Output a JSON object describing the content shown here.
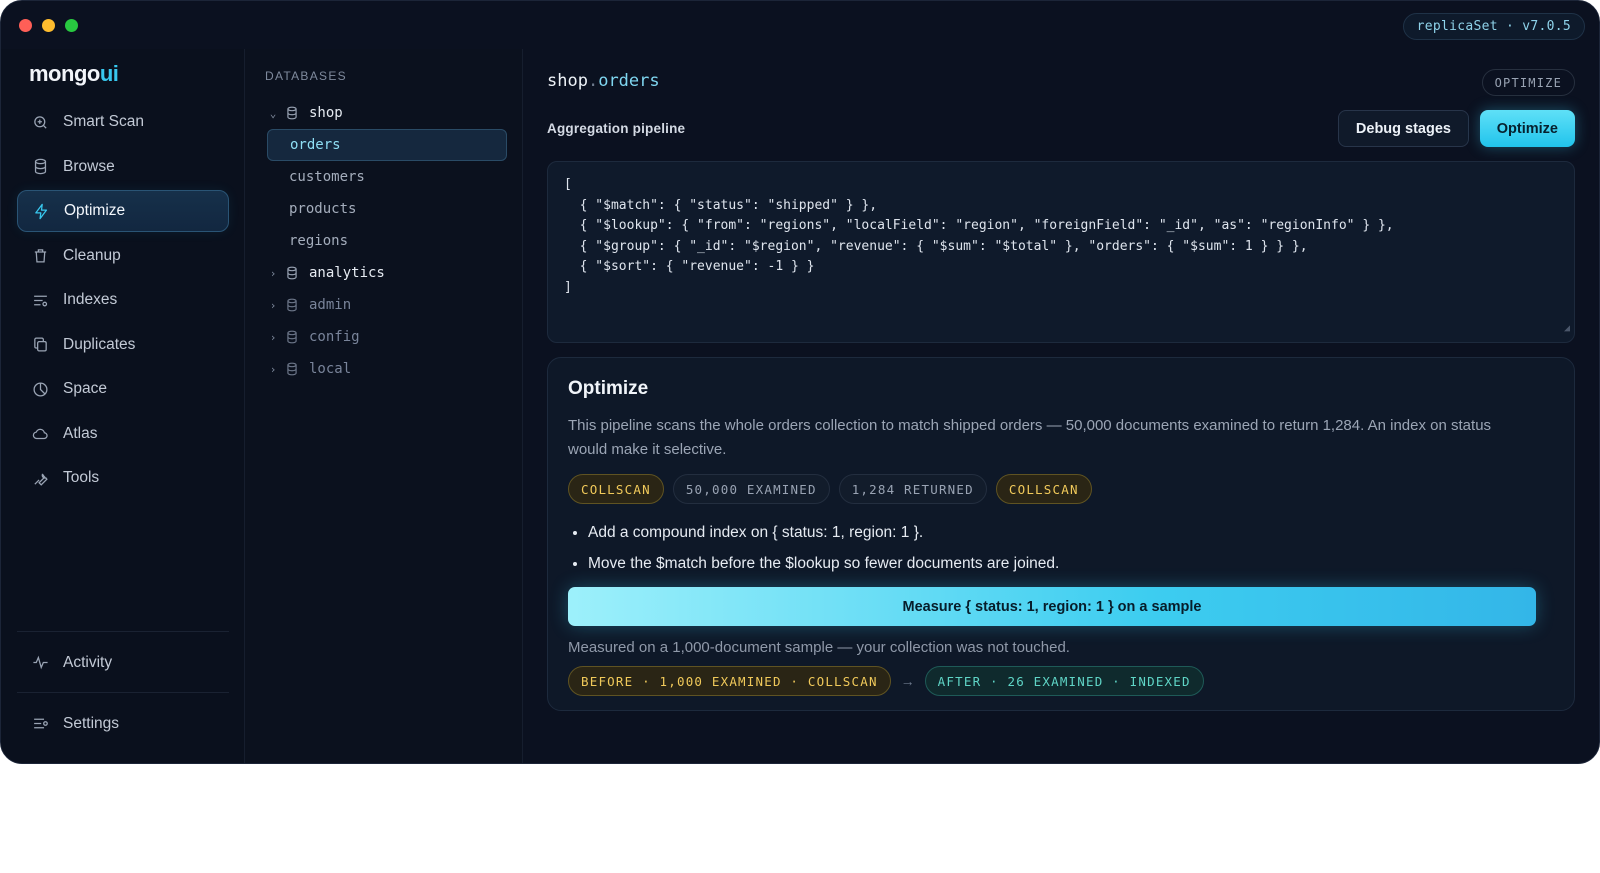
{
  "window": {
    "replica": "replicaSet · v7.0.5"
  },
  "logo": {
    "brand": "mongo",
    "accent": "ui"
  },
  "sidebar": {
    "items": [
      {
        "label": "Smart Scan",
        "icon": "smart-scan-icon"
      },
      {
        "label": "Browse",
        "icon": "database-icon"
      },
      {
        "label": "Optimize",
        "icon": "bolt-icon",
        "active": true
      },
      {
        "label": "Cleanup",
        "icon": "trash-icon"
      },
      {
        "label": "Indexes",
        "icon": "indexes-icon"
      },
      {
        "label": "Duplicates",
        "icon": "duplicates-icon"
      },
      {
        "label": "Space",
        "icon": "pie-icon"
      },
      {
        "label": "Atlas",
        "icon": "cloud-icon"
      },
      {
        "label": "Tools",
        "icon": "wrench-icon"
      }
    ],
    "bottom": [
      {
        "label": "Activity",
        "icon": "activity-icon"
      },
      {
        "label": "Settings",
        "icon": "settings-icon"
      }
    ]
  },
  "databases": {
    "heading": "DATABASES",
    "shop": {
      "name": "shop",
      "collections": [
        "orders",
        "customers",
        "products",
        "regions"
      ]
    },
    "others": [
      "analytics",
      "admin",
      "config",
      "local"
    ]
  },
  "main": {
    "db": "shop",
    "separator": ".",
    "collection": "orders",
    "tag": "OPTIMIZE",
    "pipeline_label": "Aggregation pipeline",
    "debug_button": "Debug stages",
    "optimize_button": "Optimize",
    "pipeline_code": "[\n  { \"$match\": { \"status\": \"shipped\" } },\n  { \"$lookup\": { \"from\": \"regions\", \"localField\": \"region\", \"foreignField\": \"_id\", \"as\": \"regionInfo\" } },\n  { \"$group\": { \"_id\": \"$region\", \"revenue\": { \"$sum\": \"$total\" }, \"orders\": { \"$sum\": 1 } } },\n  { \"$sort\": { \"revenue\": -1 } }\n]"
  },
  "optimize": {
    "title": "Optimize",
    "description": "This pipeline scans the whole orders collection to match shipped orders — 50,000 documents examined to return 1,284. An index on status would make it selective.",
    "pills": [
      "COLLSCAN",
      "50,000 EXAMINED",
      "1,284 RETURNED",
      "COLLSCAN"
    ],
    "suggestions": [
      "Add a compound index on { status: 1, region: 1 }.",
      "Move the $match before the $lookup so fewer documents are joined."
    ],
    "measure_button": "Measure { status: 1, region: 1 } on a sample",
    "measure_note": "Measured on a 1,000-document sample — your collection was not touched.",
    "before": "BEFORE · 1,000 EXAMINED · COLLSCAN",
    "after": "AFTER · 26 EXAMINED · INDEXED"
  },
  "colors": {
    "accent": "#38c8ef",
    "warn": "#f0c95a",
    "good": "#5fd5c6",
    "background": "#0b1120"
  }
}
